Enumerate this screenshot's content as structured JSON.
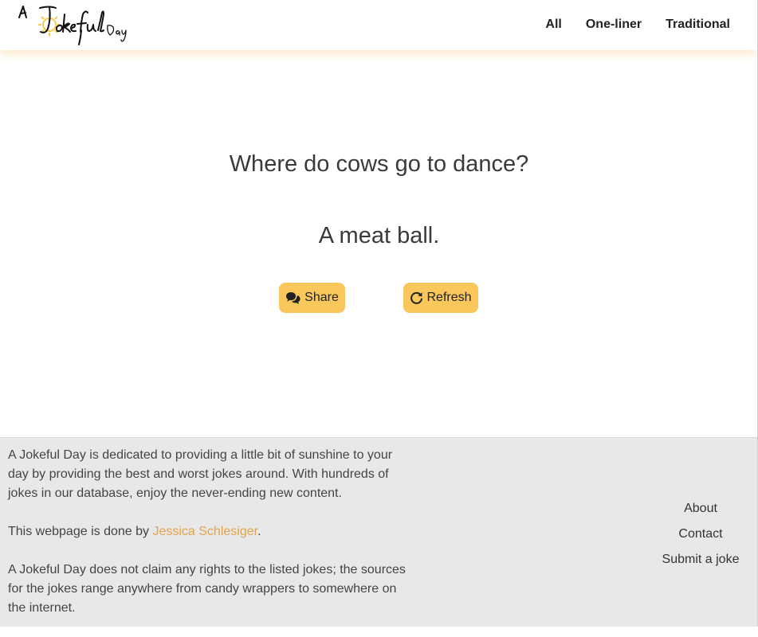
{
  "header": {
    "logo_text": "A Jokeful Day",
    "nav": [
      {
        "label": "All"
      },
      {
        "label": "One-liner"
      },
      {
        "label": "Traditional"
      }
    ]
  },
  "joke": {
    "question": "Where do cows go to dance?",
    "answer": "A meat ball.",
    "share_label": "Share",
    "refresh_label": "Refresh",
    "share_icon": "comments-icon",
    "refresh_icon": "refresh-icon"
  },
  "footer": {
    "about_text": "A Jokeful Day is dedicated to providing a little bit of sunshine to your day by providing the best and worst jokes around. With hundreds of jokes in our database, enjoy the never-ending new content.",
    "credit_prefix": "This webpage is done by ",
    "credit_name": "Jessica Schlesiger",
    "credit_suffix": ".",
    "disclaimer": "A Jokeful Day does not claim any rights to the listed jokes; the sources for the jokes range anywhere from candy wrappers to somewhere on the internet.",
    "links": [
      {
        "label": "About"
      },
      {
        "label": "Contact"
      },
      {
        "label": "Submit a joke"
      }
    ]
  },
  "colors": {
    "accent": "#f9c75b",
    "link": "#e4a34a",
    "footer_bg": "#e8e8e8",
    "sun": "#f6c94f"
  }
}
